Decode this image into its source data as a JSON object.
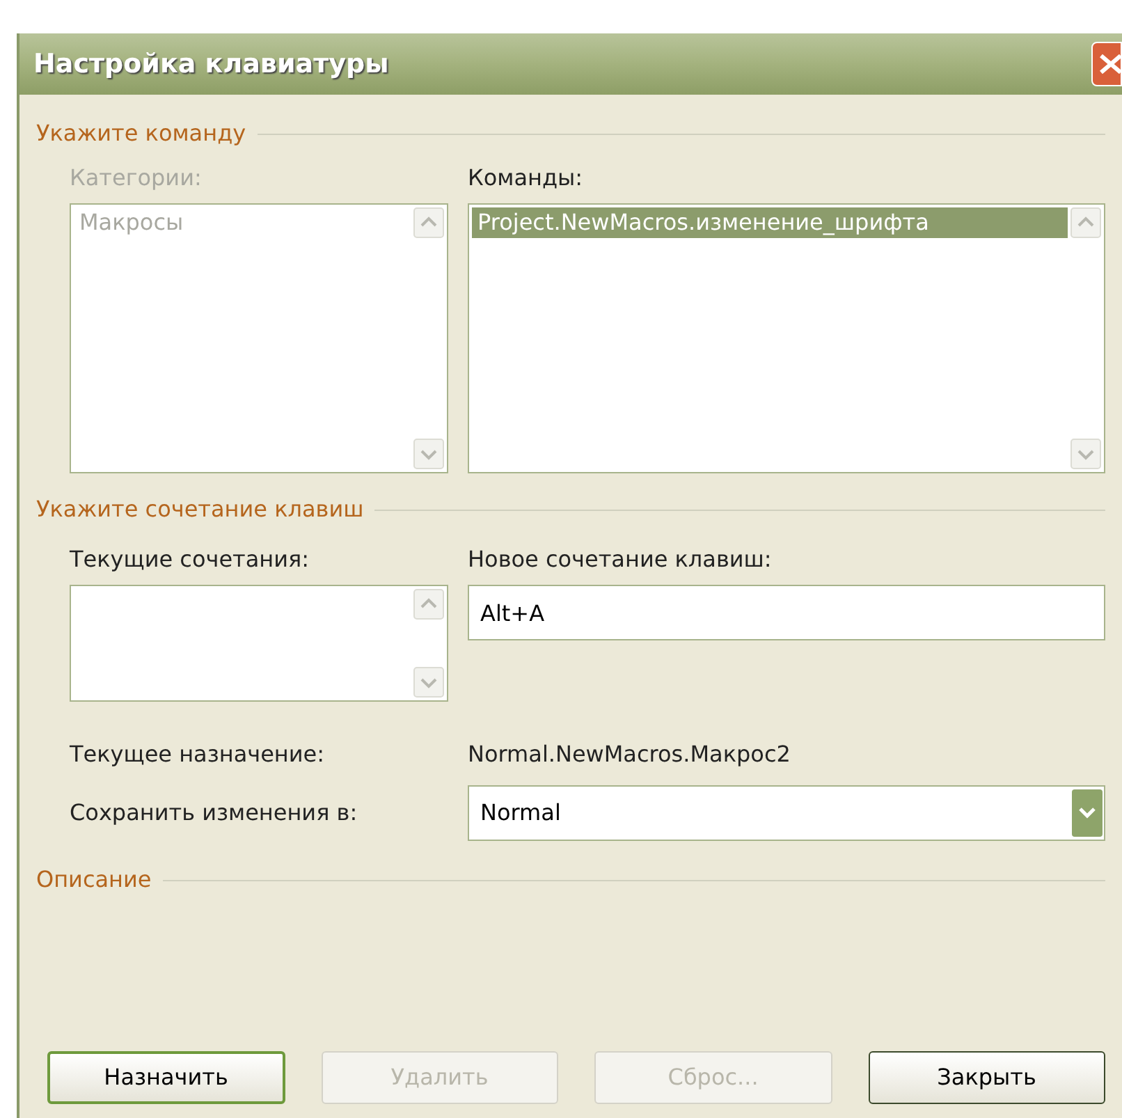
{
  "window": {
    "title": "Настройка клавиатуры"
  },
  "command_group": {
    "title": "Укажите команду",
    "categories": {
      "label": "Категории:",
      "disabled": true,
      "items": [
        {
          "text": "Макросы",
          "selected": false
        }
      ]
    },
    "commands": {
      "label": "Команды:",
      "disabled": false,
      "items": [
        {
          "text": "Project.NewMacros.изменение_шрифта",
          "selected": true
        }
      ]
    }
  },
  "shortcut_group": {
    "title": "Укажите сочетание клавиш",
    "current_keys": {
      "label": "Текущие сочетания:"
    },
    "new_key": {
      "label": "Новое сочетание клавиш:",
      "value": "Alt+A"
    },
    "current_assignment": {
      "label": "Текущее назначение:",
      "value": "Normal.NewMacros.Макрос2"
    },
    "save_in": {
      "label": "Сохранить изменения в:",
      "value": "Normal"
    }
  },
  "description_group": {
    "title": "Описание"
  },
  "buttons": [
    {
      "label": "Назначить",
      "disabled": false,
      "default": true
    },
    {
      "label": "Удалить",
      "disabled": true,
      "default": false
    },
    {
      "label": "Сброс...",
      "disabled": true,
      "default": false
    },
    {
      "label": "Закрыть",
      "disabled": false,
      "default": false
    }
  ]
}
